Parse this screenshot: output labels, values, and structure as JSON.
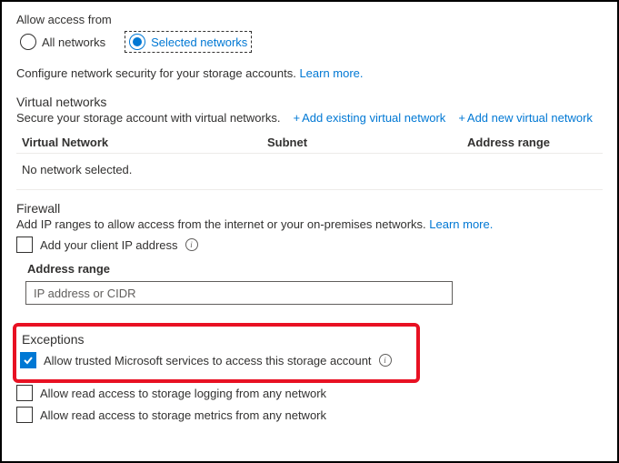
{
  "access": {
    "title": "Allow access from",
    "options": {
      "all": "All networks",
      "selected": "Selected networks"
    }
  },
  "configDesc": "Configure network security for your storage accounts.",
  "learnMore": "Learn more.",
  "virtualNetworks": {
    "heading": "Virtual networks",
    "desc": "Secure your storage account with virtual networks.",
    "addExisting": "Add existing virtual network",
    "addNew": "Add new virtual network",
    "cols": {
      "c1": "Virtual Network",
      "c2": "Subnet",
      "c3": "Address range"
    },
    "empty": "No network selected."
  },
  "firewall": {
    "heading": "Firewall",
    "desc": "Add IP ranges to allow access from the internet or your on-premises networks.",
    "addClientIp": "Add your client IP address",
    "addrLabel": "Address range",
    "addrPlaceholder": "IP address or CIDR"
  },
  "exceptions": {
    "heading": "Exceptions",
    "trusted": "Allow trusted Microsoft services to access this storage account",
    "logging": "Allow read access to storage logging from any network",
    "metrics": "Allow read access to storage metrics from any network"
  }
}
